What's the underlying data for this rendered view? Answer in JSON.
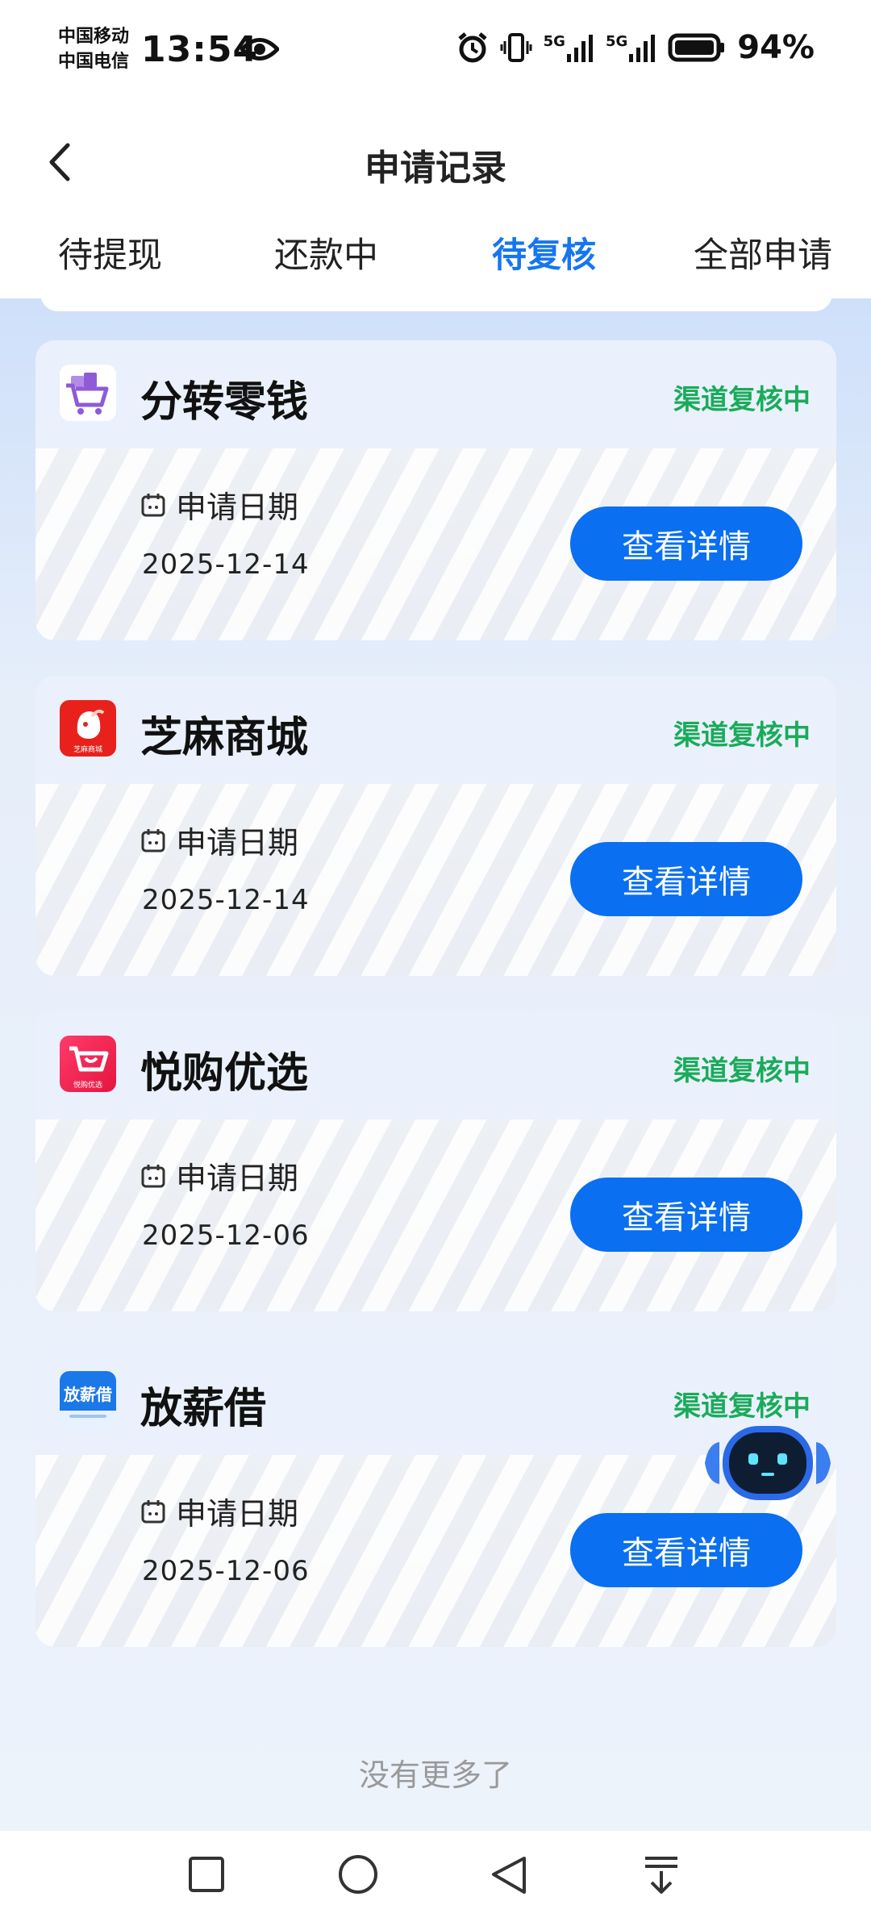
{
  "status_bar": {
    "carrier_1": "中国移动",
    "carrier_2": "中国电信",
    "time": "13:54",
    "network_1": "5G",
    "network_2": "5G",
    "battery": "94%",
    "icons": [
      "eye-icon",
      "alarm-icon",
      "vibrate-icon",
      "signal-icon",
      "signal-icon",
      "battery-icon"
    ]
  },
  "header": {
    "title": "申请记录",
    "tabs": [
      {
        "label": "待提现",
        "active": false
      },
      {
        "label": "还款中",
        "active": false
      },
      {
        "label": "待复核",
        "active": true
      },
      {
        "label": "全部申请",
        "active": false
      }
    ]
  },
  "records": [
    {
      "app_name": "分转零钱",
      "status": "渠道复核中",
      "date_label": "申请日期",
      "date": "2025-12-14",
      "button": "查看详情",
      "logo_icon": "shopping-cart-logo-icon"
    },
    {
      "app_name": "芝麻商城",
      "status": "渠道复核中",
      "date_label": "申请日期",
      "date": "2025-12-14",
      "button": "查看详情",
      "logo_icon": "mascot-logo-icon",
      "logo_text": "芝麻商城"
    },
    {
      "app_name": "悦购优选",
      "status": "渠道复核中",
      "date_label": "申请日期",
      "date": "2025-12-06",
      "button": "查看详情",
      "logo_icon": "cart-logo-icon",
      "logo_text": "悦购优选"
    },
    {
      "app_name": "放薪借",
      "status": "渠道复核中",
      "date_label": "申请日期",
      "date": "2025-12-06",
      "button": "查看详情",
      "logo_icon": "text-logo-icon",
      "logo_text": "放薪借"
    }
  ],
  "footer": {
    "no_more": "没有更多了"
  },
  "colors": {
    "accent": "#0a6ff0",
    "status_green": "#1aab5a",
    "active_tab": "#1676f0"
  },
  "nav_bar": {
    "icons": [
      "recent-apps-icon",
      "home-icon",
      "back-nav-icon",
      "notification-pull-icon"
    ]
  }
}
